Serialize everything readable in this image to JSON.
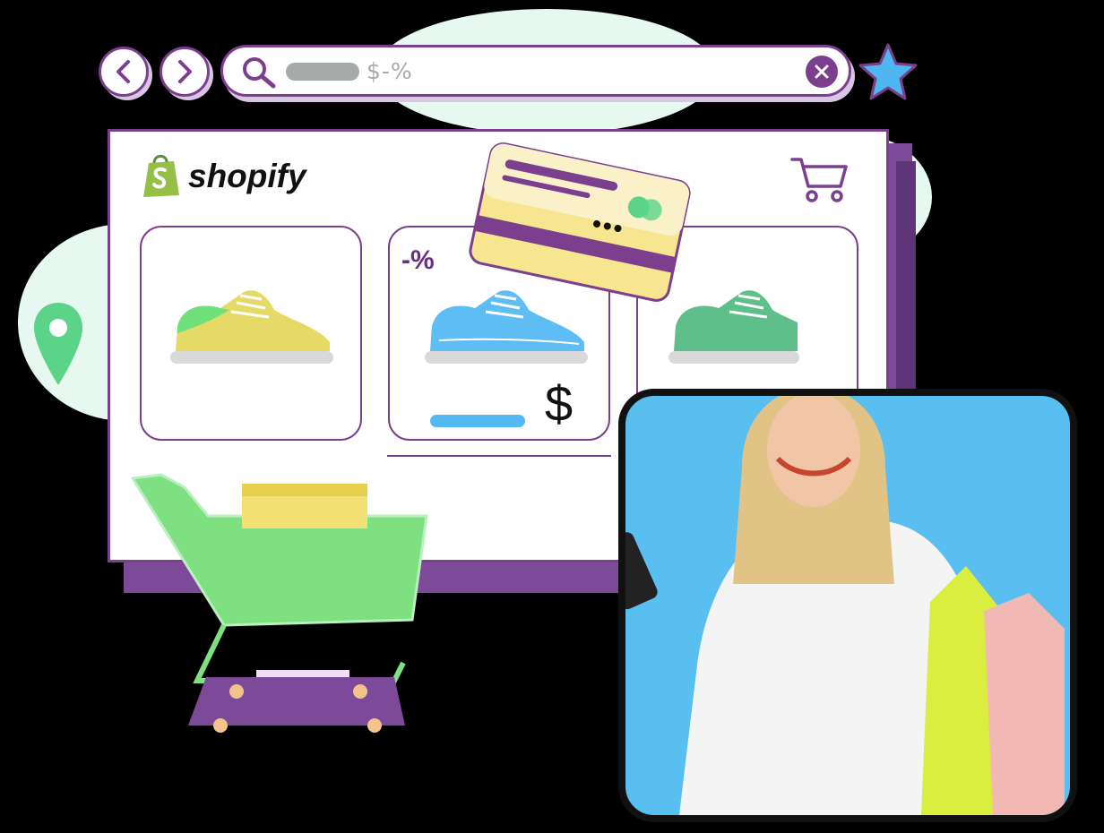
{
  "search": {
    "query_text": "$-%"
  },
  "store": {
    "brand_name": "shopify"
  },
  "products": [
    {
      "shoe_color": "#e6da66",
      "accent": "#6fe07a"
    },
    {
      "shoe_color": "#5ebdf2",
      "accent": "#ffffff",
      "badge": "-%",
      "price_symbol": "$"
    },
    {
      "shoe_color": "#5fbf8a",
      "accent": "#ffffff"
    }
  ],
  "colors": {
    "accent": "#7b3f8e",
    "brand_green": "#95bf47",
    "card_yellow": "#f7e58f",
    "cart_green": "#7ee081",
    "photo_bg": "#58bff0"
  },
  "icons": [
    "back-icon",
    "forward-icon",
    "search-icon",
    "close-icon",
    "star-icon",
    "cart-icon",
    "location-pin-icon",
    "credit-card-icon"
  ]
}
